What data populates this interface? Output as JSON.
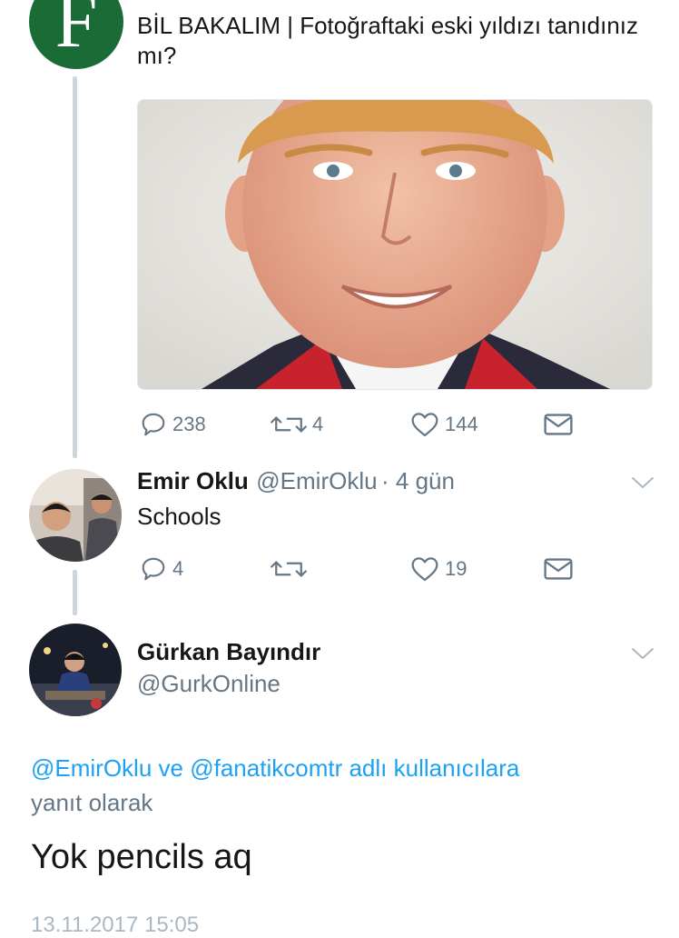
{
  "tweet_main": {
    "text": "BİL BAKALIM | Fotoğraftaki eski yıldızı tanıdınız mı?",
    "replies": "238",
    "retweets": "4",
    "likes": "144"
  },
  "reply1": {
    "name": "Emir Oklu",
    "handle": "@EmirOklu",
    "time": "· 4 gün",
    "text": "Schools",
    "replies": "4",
    "retweets": "",
    "likes": "19"
  },
  "reply2": {
    "name": "Gürkan Bayındır",
    "handle": "@GurkOnline",
    "mention1": "@EmirOklu",
    "connector": "ve",
    "mention2": "@fanatikcomtr",
    "suffix": "adlı kullanıcılara",
    "reply_label": "yanıt olarak",
    "text": "Yok pencils aq",
    "timestamp": "13.11.2017 15:05"
  },
  "colors": {
    "link": "#1da1f2",
    "muted": "#657786",
    "thread_line": "#ccd6dd"
  }
}
